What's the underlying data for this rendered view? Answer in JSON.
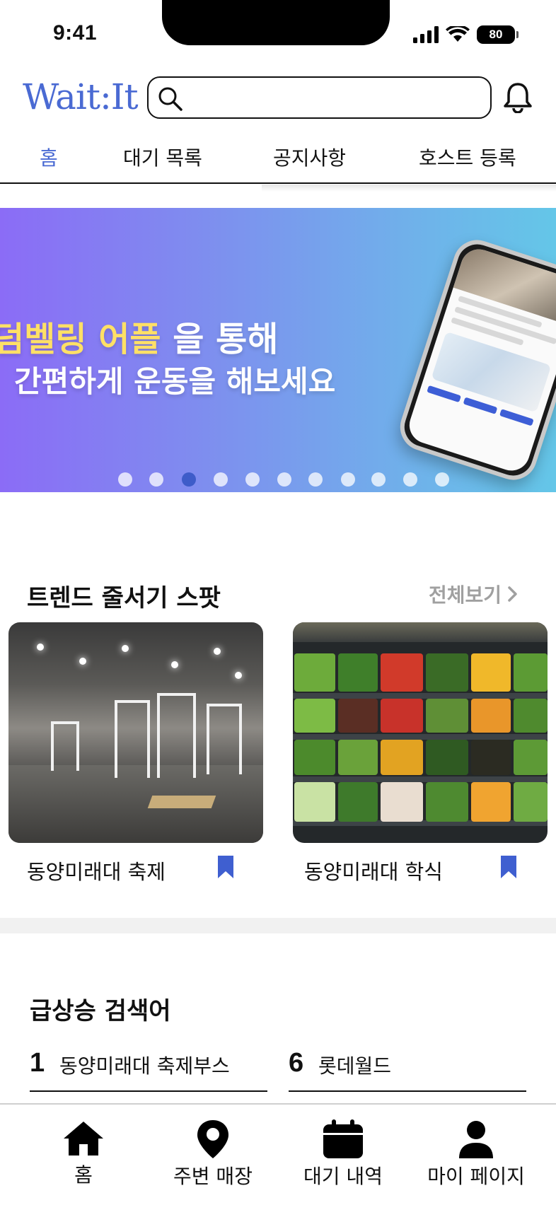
{
  "status_bar": {
    "time": "9:41",
    "battery": "80"
  },
  "header": {
    "logo": "Wait:It",
    "search_placeholder": ""
  },
  "tabs": [
    {
      "label": "홈",
      "active": true
    },
    {
      "label": "대기 목록",
      "active": false
    },
    {
      "label": "공지사항",
      "active": false
    },
    {
      "label": "호스트 등록",
      "active": false
    }
  ],
  "banner": {
    "line1_highlight": "덤벨링 어플",
    "line1_rest": " 을 통해",
    "line2": "간편하게 운동을 해보세요",
    "dot_count": 11,
    "active_dot": 3
  },
  "trending": {
    "title": "트렌드 줄서기 스팟",
    "see_all": "전체보기",
    "cards": [
      {
        "label": "동양미래대 축제",
        "image": "gym-photo"
      },
      {
        "label": "동양미래대 학식",
        "image": "produce-photo"
      }
    ]
  },
  "rising": {
    "title": "급상승 검색어",
    "items": [
      {
        "rank": "1",
        "text": "동양미래대 축제부스"
      },
      {
        "rank": "6",
        "text": "롯데월드"
      }
    ]
  },
  "bottom_nav": [
    {
      "label": "홈",
      "icon": "home-icon"
    },
    {
      "label": "주변 매장",
      "icon": "map-pin-icon"
    },
    {
      "label": "대기 내역",
      "icon": "calendar-icon"
    },
    {
      "label": "마이 페이지",
      "icon": "person-icon"
    }
  ],
  "colors": {
    "accent": "#4a6ad3",
    "bookmark": "#3f5fd0",
    "banner_start": "#8b6cf6",
    "banner_end": "#64c6e8"
  }
}
